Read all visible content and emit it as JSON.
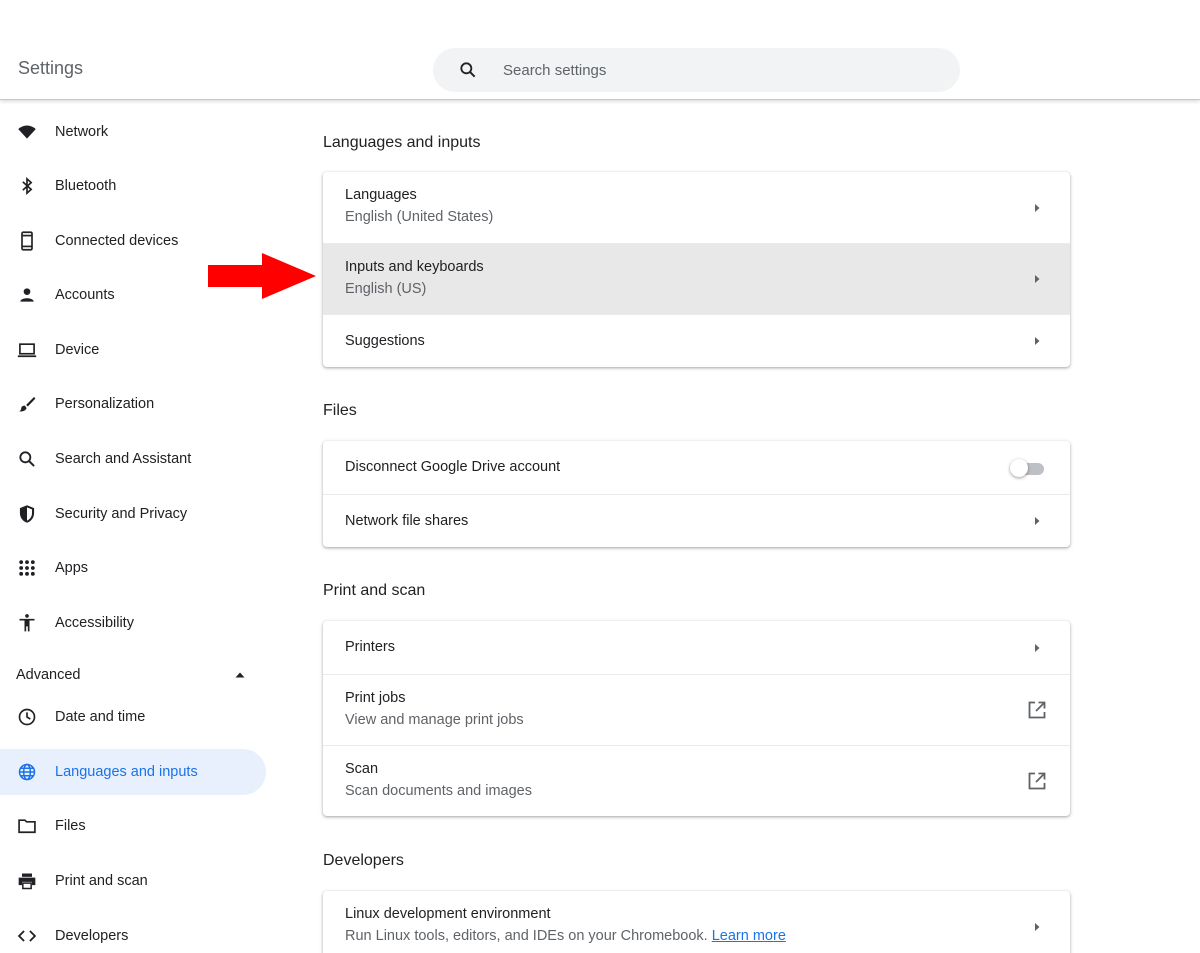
{
  "window": {
    "controls": [
      "minimize-icon",
      "maximize-icon",
      "close-icon"
    ]
  },
  "header": {
    "title": "Settings",
    "search_placeholder": "Search settings"
  },
  "sidebar": {
    "items": [
      {
        "label": "Network",
        "icon": "wifi-icon"
      },
      {
        "label": "Bluetooth",
        "icon": "bluetooth-icon"
      },
      {
        "label": "Connected devices",
        "icon": "phone-icon"
      },
      {
        "label": "Accounts",
        "icon": "person-icon"
      },
      {
        "label": "Device",
        "icon": "laptop-icon"
      },
      {
        "label": "Personalization",
        "icon": "brush-icon"
      },
      {
        "label": "Search and Assistant",
        "icon": "search-icon"
      },
      {
        "label": "Security and Privacy",
        "icon": "shield-icon"
      },
      {
        "label": "Apps",
        "icon": "apps-grid-icon"
      },
      {
        "label": "Accessibility",
        "icon": "accessibility-icon"
      }
    ],
    "advanced_label": "Advanced",
    "advanced_items": [
      {
        "label": "Date and time",
        "icon": "clock-icon"
      },
      {
        "label": "Languages and inputs",
        "icon": "globe-icon",
        "active": true
      },
      {
        "label": "Files",
        "icon": "folder-icon"
      },
      {
        "label": "Print and scan",
        "icon": "printer-icon"
      },
      {
        "label": "Developers",
        "icon": "code-icon"
      }
    ]
  },
  "main": {
    "sections": [
      {
        "title": "Languages and inputs",
        "rows": [
          {
            "title": "Languages",
            "subtitle": "English (United States)",
            "action": "arrow"
          },
          {
            "title": "Inputs and keyboards",
            "subtitle": "English (US)",
            "action": "arrow",
            "highlighted": true
          },
          {
            "title": "Suggestions",
            "action": "arrow"
          }
        ]
      },
      {
        "title": "Files",
        "rows": [
          {
            "title": "Disconnect Google Drive account",
            "action": "toggle",
            "toggle_on": false
          },
          {
            "title": "Network file shares",
            "action": "arrow"
          }
        ]
      },
      {
        "title": "Print and scan",
        "rows": [
          {
            "title": "Printers",
            "action": "arrow"
          },
          {
            "title": "Print jobs",
            "subtitle": "View and manage print jobs",
            "action": "external-link"
          },
          {
            "title": "Scan",
            "subtitle": "Scan documents and images",
            "action": "external-link"
          }
        ]
      },
      {
        "title": "Developers",
        "rows": [
          {
            "title": "Linux development environment",
            "subtitle": "Run Linux tools, editors, and IDEs on your Chromebook.",
            "link": "Learn more",
            "action": "arrow"
          }
        ]
      }
    ]
  },
  "annotation": {
    "icon": "red-arrow-icon",
    "color": "#ff0000"
  },
  "colors": {
    "accent": "#1a73e8",
    "active_bg": "#e8f0fe",
    "highlight_row": "#e8e8e8"
  }
}
